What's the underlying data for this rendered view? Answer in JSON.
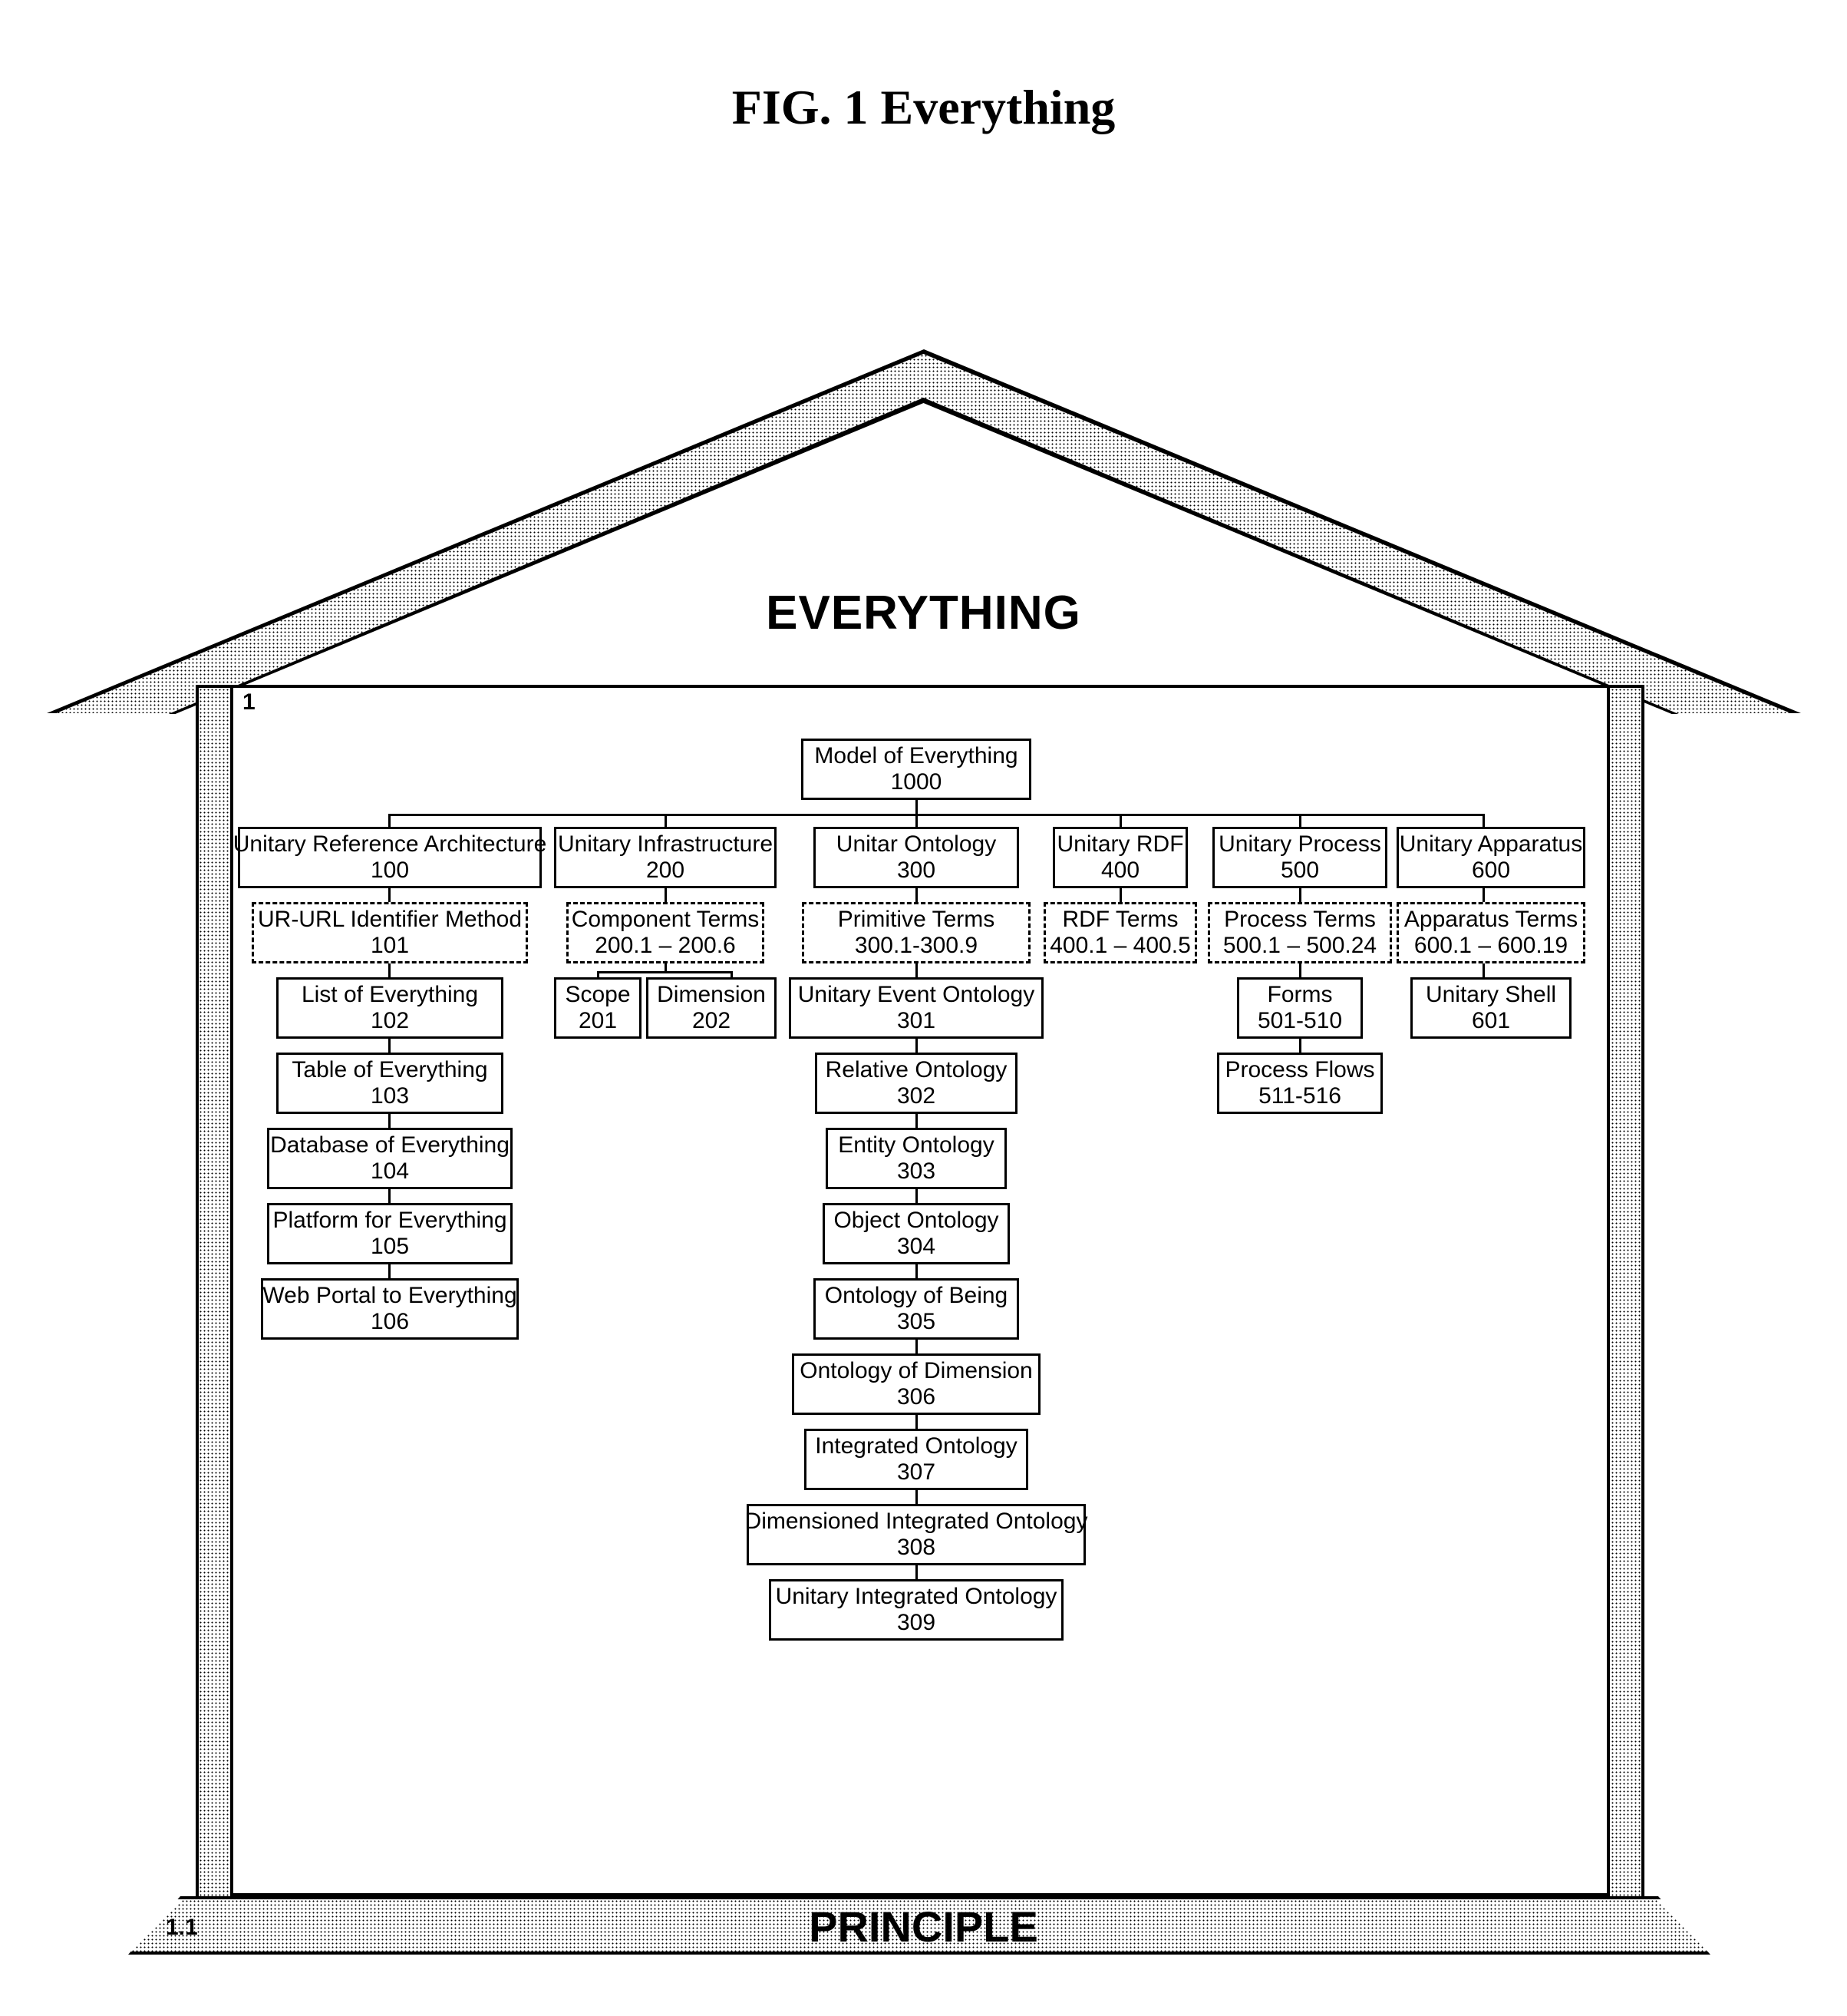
{
  "figure_title": "FIG. 1 Everything",
  "banner_text": "EVERYTHING",
  "footer_text": "PRINCIPLE",
  "inner_frame_label": "1",
  "base_label": "1.1",
  "root": {
    "name": "Model of Everything",
    "num": "1000"
  },
  "columns": [
    {
      "id": "col1",
      "head": {
        "name": "Unitary Reference Architecture",
        "num": "100"
      },
      "terms": {
        "name": "UR-URL Identifier Method",
        "num": "101"
      },
      "items": [
        {
          "name": "List of Everything",
          "num": "102"
        },
        {
          "name": "Table of Everything",
          "num": "103"
        },
        {
          "name": "Database of Everything",
          "num": "104"
        },
        {
          "name": "Platform for Everything",
          "num": "105"
        },
        {
          "name": "Web Portal to Everything",
          "num": "106"
        }
      ]
    },
    {
      "id": "col2",
      "head": {
        "name": "Unitary Infrastructure",
        "num": "200"
      },
      "terms": {
        "name": "Component Terms",
        "num": "200.1 – 200.6"
      },
      "row": [
        {
          "name": "Scope",
          "num": "201"
        },
        {
          "name": "Dimension",
          "num": "202"
        }
      ]
    },
    {
      "id": "col3",
      "head": {
        "name": "Unitar Ontology",
        "num": "300"
      },
      "terms": {
        "name": "Primitive Terms",
        "num": "300.1-300.9"
      },
      "items": [
        {
          "name": "Unitary Event Ontology",
          "num": "301"
        },
        {
          "name": "Relative Ontology",
          "num": "302"
        },
        {
          "name": "Entity Ontology",
          "num": "303"
        },
        {
          "name": "Object Ontology",
          "num": "304"
        },
        {
          "name": "Ontology of Being",
          "num": "305"
        },
        {
          "name": "Ontology of Dimension",
          "num": "306"
        },
        {
          "name": "Integrated Ontology",
          "num": "307"
        },
        {
          "name": "Dimensioned Integrated Ontology",
          "num": "308"
        },
        {
          "name": "Unitary Integrated Ontology",
          "num": "309"
        }
      ]
    },
    {
      "id": "col4",
      "head": {
        "name": "Unitary RDF",
        "num": "400"
      },
      "terms": {
        "name": "RDF Terms",
        "num": "400.1 – 400.5"
      }
    },
    {
      "id": "col5",
      "head": {
        "name": "Unitary Process",
        "num": "500"
      },
      "terms": {
        "name": "Process Terms",
        "num": "500.1 – 500.24"
      },
      "items": [
        {
          "name": "Forms",
          "num": "501-510"
        },
        {
          "name": "Process Flows",
          "num": "511-516"
        }
      ]
    },
    {
      "id": "col6",
      "head": {
        "name": "Unitary Apparatus",
        "num": "600"
      },
      "terms": {
        "name": "Apparatus Terms",
        "num": "600.1 – 600.19"
      },
      "items": [
        {
          "name": "Unitary Shell",
          "num": "601"
        }
      ]
    }
  ]
}
